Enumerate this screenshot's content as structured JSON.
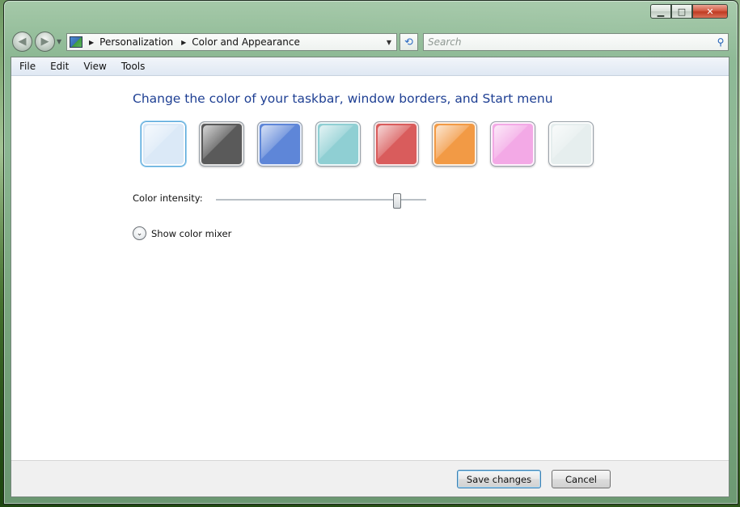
{
  "window": {
    "caption_buttons": {
      "minimize": "▁",
      "maximize": "□",
      "close": "✕"
    }
  },
  "navigation": {
    "back_glyph": "◀",
    "forward_glyph": "▶",
    "breadcrumbs": [
      {
        "label": "Personalization"
      },
      {
        "label": "Color and Appearance"
      }
    ],
    "search_placeholder": "Search"
  },
  "menu": [
    "File",
    "Edit",
    "View",
    "Tools"
  ],
  "main": {
    "heading": "Change the color of your taskbar, window borders, and Start menu",
    "swatches": [
      {
        "name": "default",
        "color": "#dbe9f7"
      },
      {
        "name": "graphite",
        "color": "#5a5a5a"
      },
      {
        "name": "blue",
        "color": "#5e86d8"
      },
      {
        "name": "teal",
        "color": "#8fcfd3"
      },
      {
        "name": "red",
        "color": "#d95c5c"
      },
      {
        "name": "orange",
        "color": "#f29a45"
      },
      {
        "name": "pink",
        "color": "#f3a9e6"
      },
      {
        "name": "frost",
        "color": "#e6eeee"
      }
    ],
    "intensity_label": "Color intensity:",
    "intensity_value": 0.86,
    "mixer_label": "Show color mixer"
  },
  "footer": {
    "save_label": "Save changes",
    "cancel_label": "Cancel"
  }
}
